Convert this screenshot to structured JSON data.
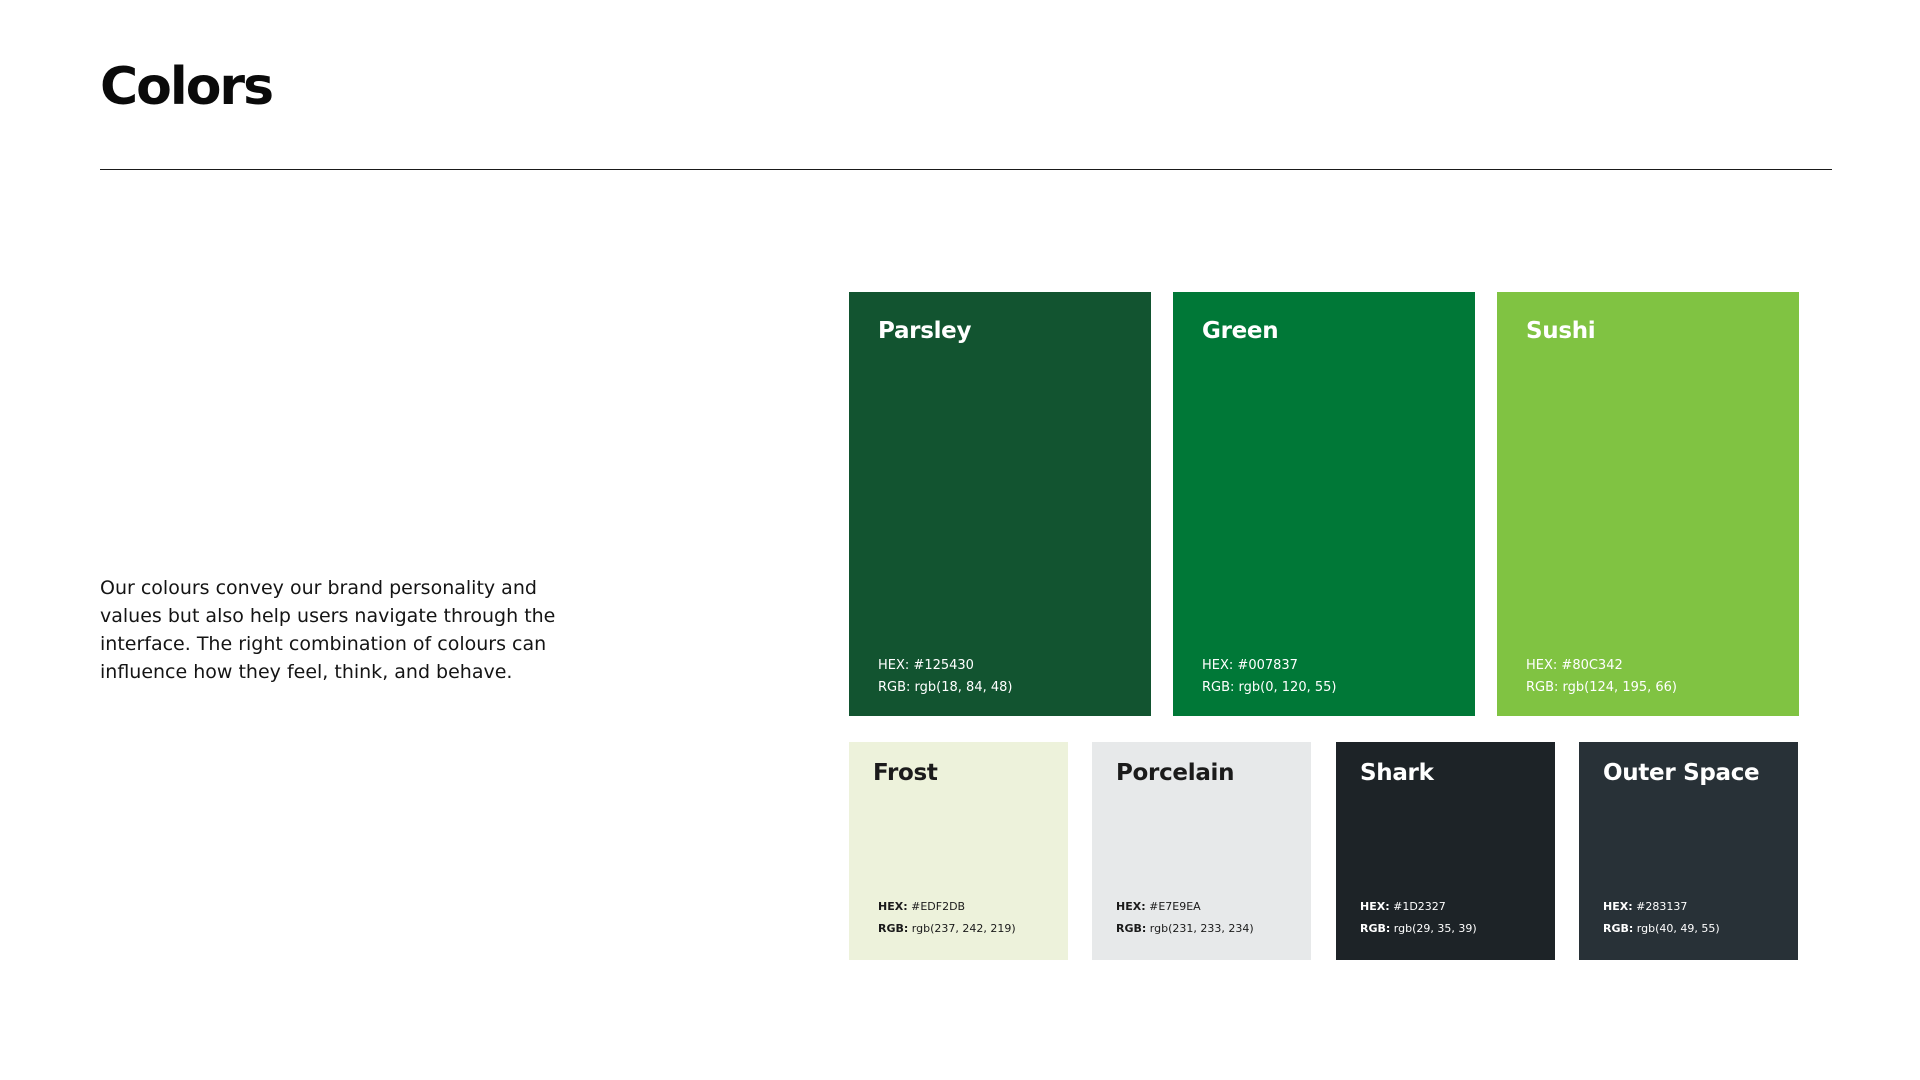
{
  "page": {
    "title": "Colors",
    "intro": "Our colours convey our brand personality and values but also help users navigate through the interface. The right combination of colours can influence how they feel, think, and behave."
  },
  "primary_colors": [
    {
      "name": "Parsley",
      "hex_label": "HEX:",
      "hex": "#125430",
      "rgb_label": "RGB:",
      "rgb": "rgb(18, 84, 48)"
    },
    {
      "name": "Green",
      "hex_label": "HEX:",
      "hex": "#007837",
      "rgb_label": "RGB:",
      "rgb": "rgb(0, 120, 55)"
    },
    {
      "name": "Sushi",
      "hex_label": "HEX:",
      "hex": "#80C342",
      "rgb_label": "RGB:",
      "rgb": "rgb(124, 195, 66)"
    }
  ],
  "secondary_colors": [
    {
      "name": "Frost",
      "hex_label": "HEX:",
      "hex": "#EDF2DB",
      "rgb_label": "RGB:",
      "rgb": "rgb(237, 242, 219)"
    },
    {
      "name": "Porcelain",
      "hex_label": "HEX:",
      "hex": "#E7E9EA",
      "rgb_label": "RGB:",
      "rgb": "rgb(231, 233, 234)"
    },
    {
      "name": "Shark",
      "hex_label": "HEX:",
      "hex": "#1D2327",
      "rgb_label": "RGB:",
      "rgb": "rgb(29, 35, 39)"
    },
    {
      "name": "Outer Space",
      "hex_label": "HEX:",
      "hex": "#283137",
      "rgb_label": "RGB:",
      "rgb": "rgb(40, 49, 55)"
    }
  ]
}
